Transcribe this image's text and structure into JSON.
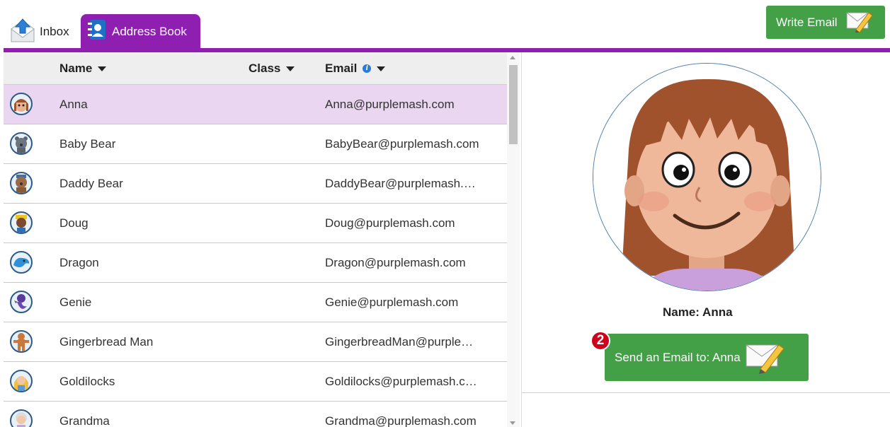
{
  "tabs": {
    "inbox_label": "Inbox",
    "address_book_label": "Address Book"
  },
  "toolbar": {
    "write_email_label": "Write Email"
  },
  "table": {
    "columns": [
      "Name",
      "Class",
      "Email"
    ],
    "rows": [
      {
        "name": "Anna",
        "email": "Anna@purplemash.com",
        "avatar": "anna-avatar",
        "selected": true
      },
      {
        "name": "Baby Bear",
        "email": "BabyBear@purplemash.com",
        "avatar": "baby-bear-avatar"
      },
      {
        "name": "Daddy Bear",
        "email": "DaddyBear@purplemash.…",
        "avatar": "daddy-bear-avatar"
      },
      {
        "name": "Doug",
        "email": "Doug@purplemash.com",
        "avatar": "doug-avatar"
      },
      {
        "name": "Dragon",
        "email": "Dragon@purplemash.com",
        "avatar": "dragon-avatar"
      },
      {
        "name": "Genie",
        "email": "Genie@purplemash.com",
        "avatar": "genie-avatar"
      },
      {
        "name": "Gingerbread Man",
        "email": "GingerbreadMan@purple…",
        "avatar": "gingerbread-man-avatar"
      },
      {
        "name": "Goldilocks",
        "email": "Goldilocks@purplemash.c…",
        "avatar": "goldilocks-avatar"
      },
      {
        "name": "Grandma",
        "email": "Grandma@purplemash.com",
        "avatar": "grandma-avatar"
      }
    ]
  },
  "detail": {
    "name_label": "Name: Anna",
    "send_button_label": "Send an Email to: Anna",
    "step_badge": "2"
  },
  "colors": {
    "accent_purple": "#8f1fb0",
    "selected_row": "#ead6f1",
    "button_green": "#43a047",
    "badge_red": "#d0021b"
  }
}
